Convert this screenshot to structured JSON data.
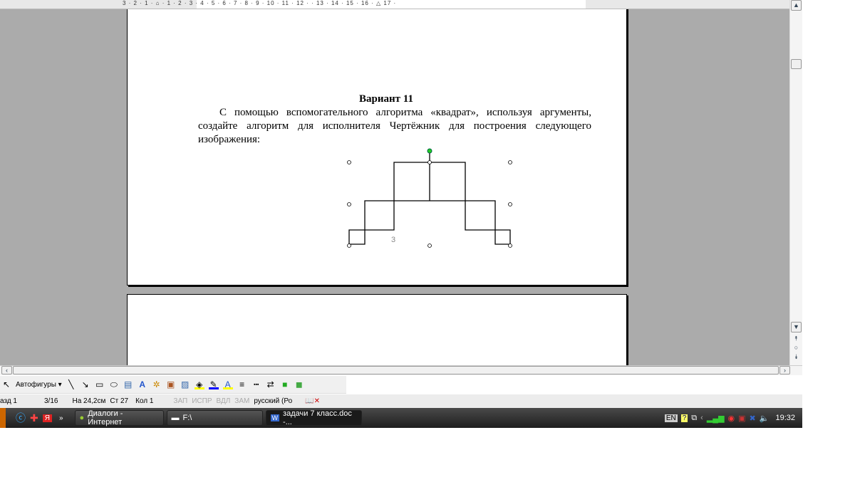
{
  "ruler": {
    "numbers": "3 · 2 · 1 ·  ⌂ · 1 · 2 · 3 · 4 · 5 · 6 · 7 · 8 · 9 · 10 · 11 · 12 ·  · 13 · 14 · 15 · 16 · △ 17 ·"
  },
  "document": {
    "title": "Вариант 11",
    "text": "С помощью вспомогательного алгоритма «квадрат», используя аргументы, создайте алгоритм для исполнителя Чертёжник для построения следующего изображения:",
    "drawing_label": "3"
  },
  "drawing_toolbar": {
    "autoshapes": "Автофигуры ▾",
    "tools": [
      "select-arrow-icon",
      "line-icon",
      "arrow-icon",
      "rectangle-icon",
      "oval-icon",
      "textbox-icon",
      "wordart-icon",
      "diagram-icon",
      "clipart-icon",
      "picture-icon",
      "fill-color-icon",
      "line-color-icon",
      "font-color-icon",
      "line-style-icon",
      "dash-style-icon",
      "arrow-style-icon",
      "shadow-icon",
      "3d-icon"
    ],
    "font_color_letter": "A"
  },
  "status": {
    "section": "азд 1",
    "pages": "3/16",
    "position": "На 24,2см",
    "line": "Ст 27",
    "column": "Кол 1",
    "rec": "ЗАП",
    "trk": "ИСПР",
    "ext": "ВДЛ",
    "ovr": "ЗАМ",
    "language": "русский (Ро"
  },
  "taskbar": {
    "items": [
      {
        "label": "Диалоги - Интернет"
      },
      {
        "label": "F:\\"
      },
      {
        "label": "задачи 7 класс.doc -..."
      }
    ],
    "lang": "EN",
    "clock": "19:32"
  },
  "colors": {
    "workspace": "#ababab",
    "taskbar": "#2a2a2a",
    "handle_rotate": "#22cc22"
  }
}
